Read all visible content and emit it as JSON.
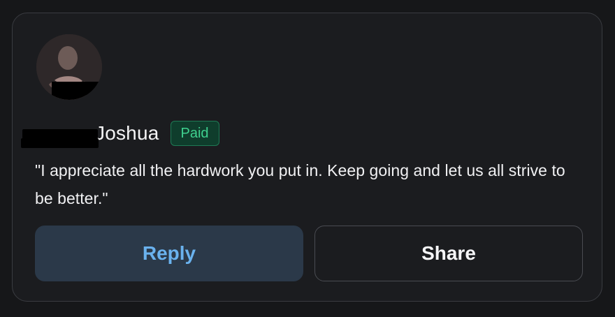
{
  "comment_card": {
    "author": {
      "visible_name": "Joshua",
      "badge": "Paid"
    },
    "comment_text": "\"I appreciate all the hardwork you put in. Keep going and let us all strive to be better.\"",
    "actions": {
      "reply_label": "Reply",
      "share_label": "Share"
    }
  },
  "colors": {
    "card_background": "#1b1c1f",
    "card_border": "#3a3c41",
    "paid_badge_background": "#0f3d2c",
    "paid_badge_text": "#3fd18f",
    "reply_button_background": "#2b3949",
    "reply_button_text": "#6ab2ee",
    "share_button_border": "#4a4c52"
  },
  "icons": {
    "avatar": "user-avatar-photo"
  }
}
